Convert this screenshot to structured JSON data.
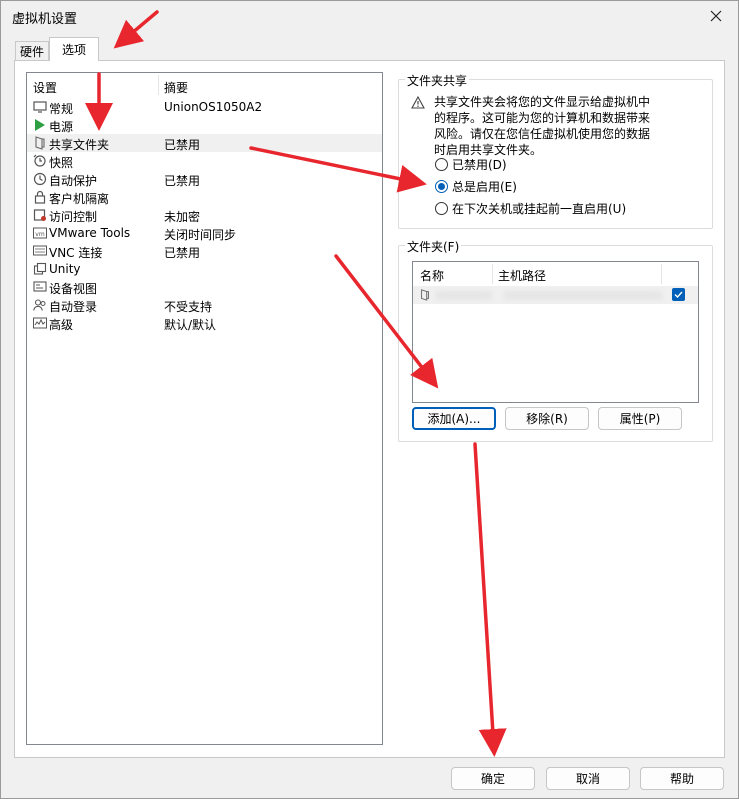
{
  "window": {
    "title": "虚拟机设置"
  },
  "tabs": [
    {
      "label": "硬件",
      "active": false
    },
    {
      "label": "选项",
      "active": true
    }
  ],
  "settings_list": {
    "columns": [
      "设置",
      "摘要"
    ],
    "items": [
      {
        "name": "常规",
        "summary": "UnionOS1050A2",
        "icon": "monitor-icon"
      },
      {
        "name": "电源",
        "summary": "",
        "icon": "play-icon"
      },
      {
        "name": "共享文件夹",
        "summary": "已禁用",
        "icon": "shared-folder-icon",
        "selected": true
      },
      {
        "name": "快照",
        "summary": "",
        "icon": "snapshot-icon"
      },
      {
        "name": "自动保护",
        "summary": "已禁用",
        "icon": "clock-icon"
      },
      {
        "name": "客户机隔离",
        "summary": "",
        "icon": "lock-icon"
      },
      {
        "name": "访问控制",
        "summary": "未加密",
        "icon": "access-control-icon"
      },
      {
        "name": "VMware Tools",
        "summary": "关闭时间同步",
        "icon": "vm-icon"
      },
      {
        "name": "VNC 连接",
        "summary": "已禁用",
        "icon": "vnc-icon"
      },
      {
        "name": "Unity",
        "summary": "",
        "icon": "unity-icon"
      },
      {
        "name": "设备视图",
        "summary": "",
        "icon": "device-view-icon"
      },
      {
        "name": "自动登录",
        "summary": "不受支持",
        "icon": "users-icon"
      },
      {
        "name": "高级",
        "summary": "默认/默认",
        "icon": "advanced-icon"
      }
    ]
  },
  "folder_sharing": {
    "title": "文件夹共享",
    "warning": "共享文件夹会将您的文件显示给虚拟机中的程序。这可能为您的计算机和数据带来风险。请仅在您信任虚拟机使用您的数据时启用共享文件夹。",
    "options": [
      {
        "label": "已禁用(D)",
        "checked": false
      },
      {
        "label": "总是启用(E)",
        "checked": true
      },
      {
        "label": "在下次关机或挂起前一直启用(U)",
        "checked": false
      }
    ]
  },
  "folders": {
    "title": "文件夹(F)",
    "columns": [
      "名称",
      "主机路径"
    ],
    "row_checked": true,
    "buttons": {
      "add": "添加(A)...",
      "remove": "移除(R)",
      "properties": "属性(P)"
    }
  },
  "footer": {
    "ok": "确定",
    "cancel": "取消",
    "help": "帮助"
  },
  "colors": {
    "accent": "#005fb8",
    "annotation_arrow": "#e8262d",
    "selected_row": "#f0f0f0"
  }
}
